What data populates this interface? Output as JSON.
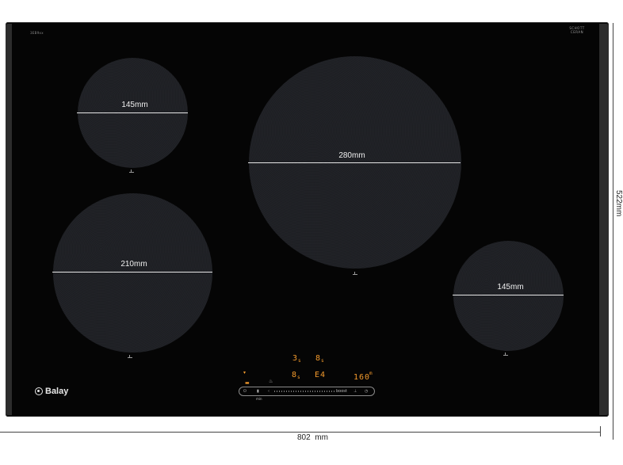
{
  "hob": {
    "brand_small": "3EB9xx",
    "schott_label": "SCHOTT CERAN",
    "brand": "Balay",
    "zones": [
      {
        "id": "top-left",
        "label": "145mm"
      },
      {
        "id": "center",
        "label": "280mm"
      },
      {
        "id": "bottom-left",
        "label": "210mm"
      },
      {
        "id": "right",
        "label": "145mm"
      }
    ],
    "display": {
      "row1_a": "3",
      "row1_a_sub": "s",
      "row1_b": "8",
      "row1_b_sub": "s",
      "row2_a": "8",
      "row2_a_sub": "s",
      "row2_b": "E4",
      "timer": "160",
      "timer_unit": "m"
    },
    "panel": {
      "power_icon": "power-icon",
      "boost_label": "boost",
      "min_label": "min"
    }
  },
  "dimensions": {
    "width_label": "802  mm",
    "height_label": "522mm"
  },
  "colors": {
    "display": "#f39a2c",
    "glass": "#050505"
  }
}
